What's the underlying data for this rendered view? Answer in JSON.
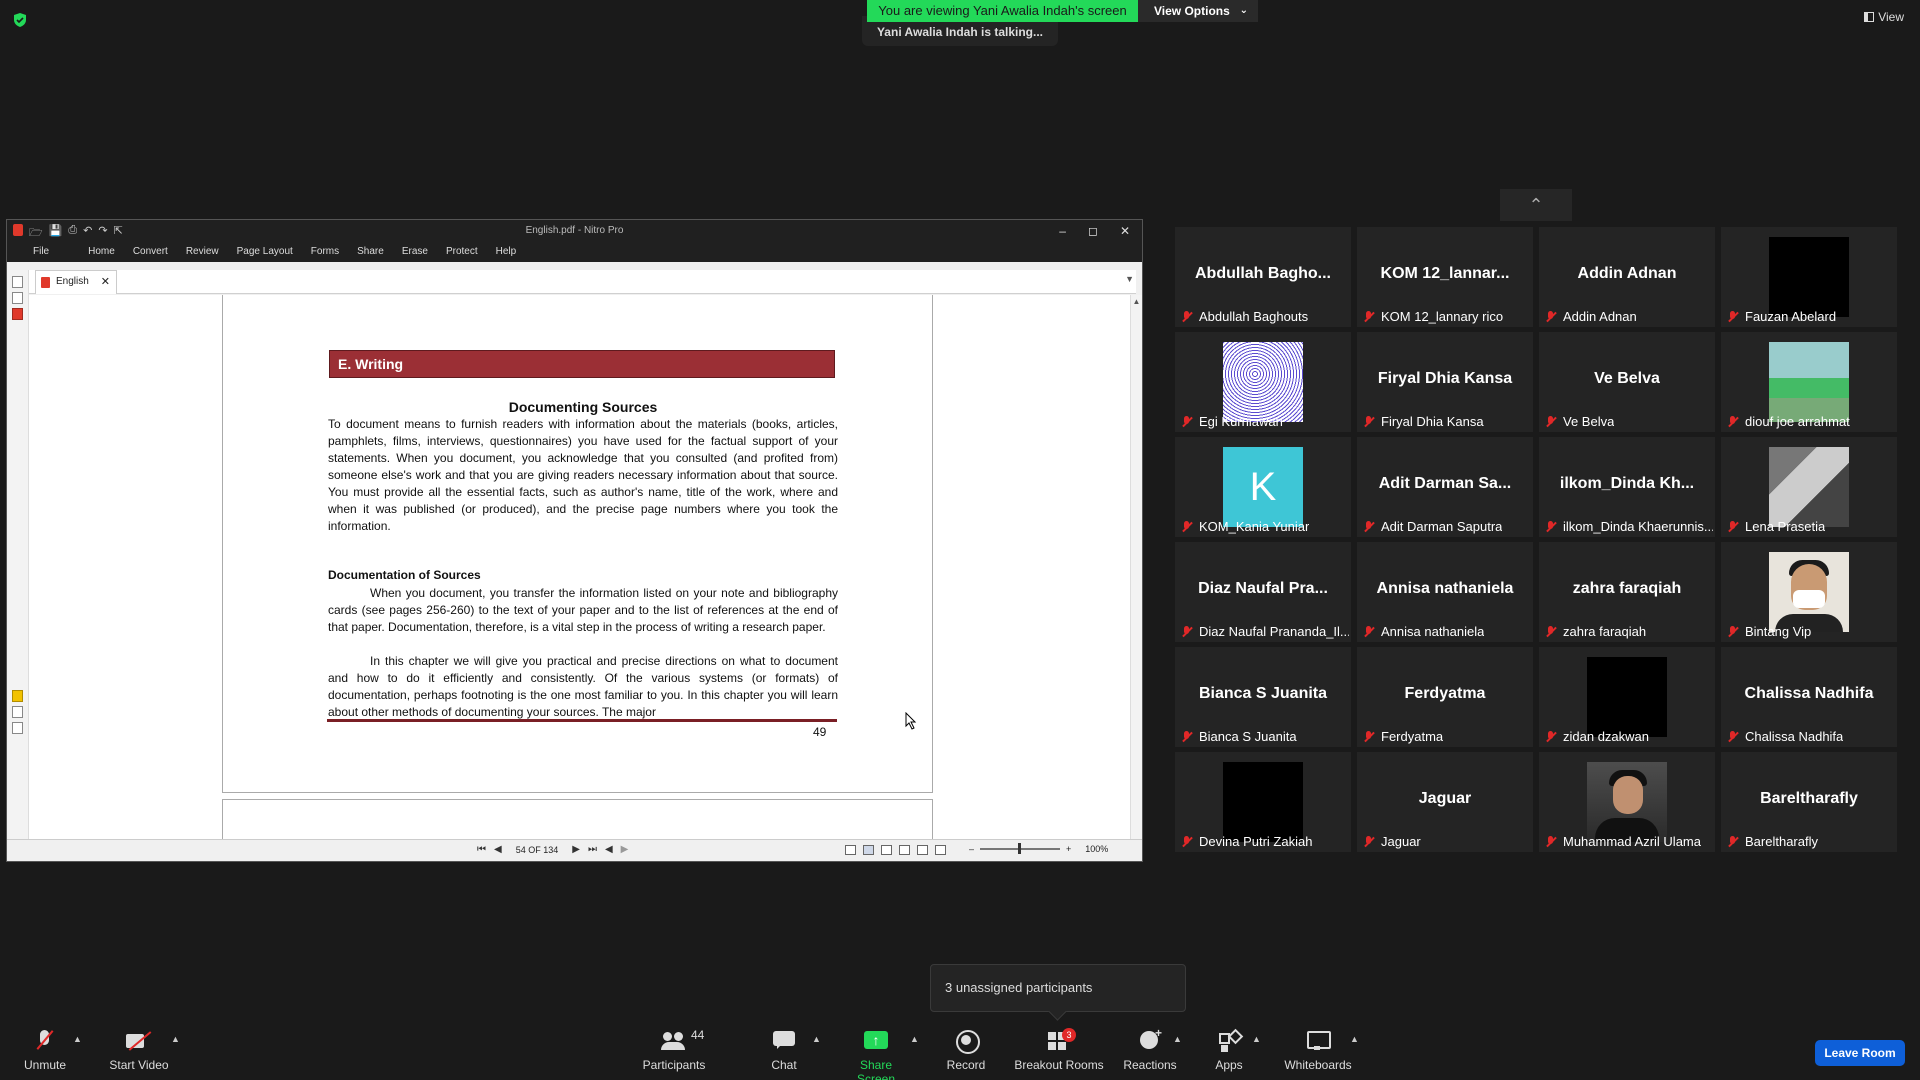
{
  "banner": {
    "viewing_text": "You are viewing Yani Awalia Indah's screen",
    "view_options_label": "View Options",
    "talking_text": "Yani Awalia Indah is talking...",
    "view_label": "View"
  },
  "pdf_app": {
    "title": "English.pdf - Nitro Pro",
    "menu": [
      "File",
      "Home",
      "Convert",
      "Review",
      "Page Layout",
      "Forms",
      "Share",
      "Erase",
      "Protect",
      "Help"
    ],
    "tab_label": "English",
    "page_indicator": "54 OF 134",
    "zoom": "100%",
    "document": {
      "section_header": "E. Writing",
      "title": "Documenting Sources",
      "paragraph1": "To document means to furnish readers with information about the materials (books, articles, pamphlets, films, interviews, questionnaires) you have used for the factual support of your statements. When you document, you acknowledge that you consulted (and profited from) someone else's work and that you are giving readers necessary information about that source. You must provide all the essential facts, such as author's name, title of the work, where and when it was published (or produced), and the precise page numbers where you took the information.",
      "subheading": "Documentation of Sources",
      "paragraph2": "When you document, you transfer the information listed on your note and bibliography cards (see pages 256-260) to the text of your paper and to the list of references at the end of that paper. Documentation, therefore, is a vital step in the process of writing a research paper.",
      "paragraph3": "In this chapter we will give you practical and precise directions on what to document and how to do it efficiently and consistently. Of the various systems (or formats) of documentation, perhaps footnoting is the one most familiar to you. In this chapter you will learn about other methods of documenting your sources. The major",
      "page_number": "49"
    }
  },
  "participants": [
    {
      "display": "Abdullah  Bagho...",
      "name": "Abdullah Baghouts",
      "avatar": "none"
    },
    {
      "display": "KOM 12_lannar...",
      "name": "KOM 12_lannary rico",
      "avatar": "none"
    },
    {
      "display": "Addin Adnan",
      "name": "Addin Adnan",
      "avatar": "none"
    },
    {
      "display": "",
      "name": "Fauzan Abelard",
      "avatar": "black"
    },
    {
      "display": "",
      "name": "Egi Kurniawan",
      "avatar": "scribble"
    },
    {
      "display": "Firyal Dhia Kansa",
      "name": "Firyal Dhia Kansa",
      "avatar": "none"
    },
    {
      "display": "Ve Belva",
      "name": "Ve Belva",
      "avatar": "none"
    },
    {
      "display": "",
      "name": "diouf joe arrahmat",
      "avatar": "photo1"
    },
    {
      "display": "K",
      "name": "KOM_Kania Yuniar",
      "avatar": "k"
    },
    {
      "display": "Adit Darman Sa...",
      "name": "Adit Darman Saputra",
      "avatar": "none"
    },
    {
      "display": "ilkom_Dinda  Kh...",
      "name": "ilkom_Dinda Khaerunnis...",
      "avatar": "none"
    },
    {
      "display": "",
      "name": "Lena Prasetia",
      "avatar": "photo2"
    },
    {
      "display": "Diaz  Naufal  Pra...",
      "name": "Diaz Naufal Prananda_Il...",
      "avatar": "none"
    },
    {
      "display": "Annisa nathaniela",
      "name": "Annisa nathaniela",
      "avatar": "none"
    },
    {
      "display": "zahra faraqiah",
      "name": "zahra faraqiah",
      "avatar": "none"
    },
    {
      "display": "",
      "name": "Bintang Vip",
      "avatar": "photo3"
    },
    {
      "display": "Bianca S Juanita",
      "name": "Bianca S Juanita",
      "avatar": "none"
    },
    {
      "display": "Ferdyatma",
      "name": "Ferdyatma",
      "avatar": "none"
    },
    {
      "display": "",
      "name": "zidan dzakwan",
      "avatar": "black"
    },
    {
      "display": "Chalissa Nadhifa",
      "name": "Chalissa Nadhifa",
      "avatar": "none"
    },
    {
      "display": "",
      "name": "Devina Putri Zakiah",
      "avatar": "black"
    },
    {
      "display": "Jaguar",
      "name": "Jaguar",
      "avatar": "none"
    },
    {
      "display": "",
      "name": "Muhammad Azril Ulama",
      "avatar": "photo4"
    },
    {
      "display": "Bareltharafly",
      "name": "Bareltharafly",
      "avatar": "none"
    }
  ],
  "breakout_tip": "3 unassigned participants",
  "toolbar": {
    "unmute": "Unmute",
    "start_video": "Start Video",
    "participants": "Participants",
    "participants_count": "44",
    "chat": "Chat",
    "share_screen": "Share Screen",
    "record": "Record",
    "breakout_rooms": "Breakout Rooms",
    "breakout_badge": "3",
    "reactions": "Reactions",
    "apps": "Apps",
    "whiteboards": "Whiteboards",
    "leave": "Leave Room"
  },
  "colors": {
    "accent_green": "#23d959",
    "mute_red": "#e02828",
    "section_red": "#9b2f35",
    "leave_blue": "#0e5fd8"
  }
}
